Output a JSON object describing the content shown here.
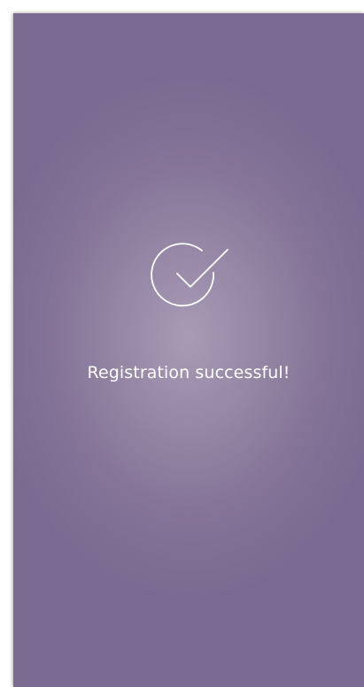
{
  "screen": {
    "background_colors": [
      "#a99bb5",
      "#7a6a91"
    ],
    "icon": {
      "name": "check-circle-icon",
      "color": "#ffffff"
    },
    "message": "Registration successful!"
  }
}
